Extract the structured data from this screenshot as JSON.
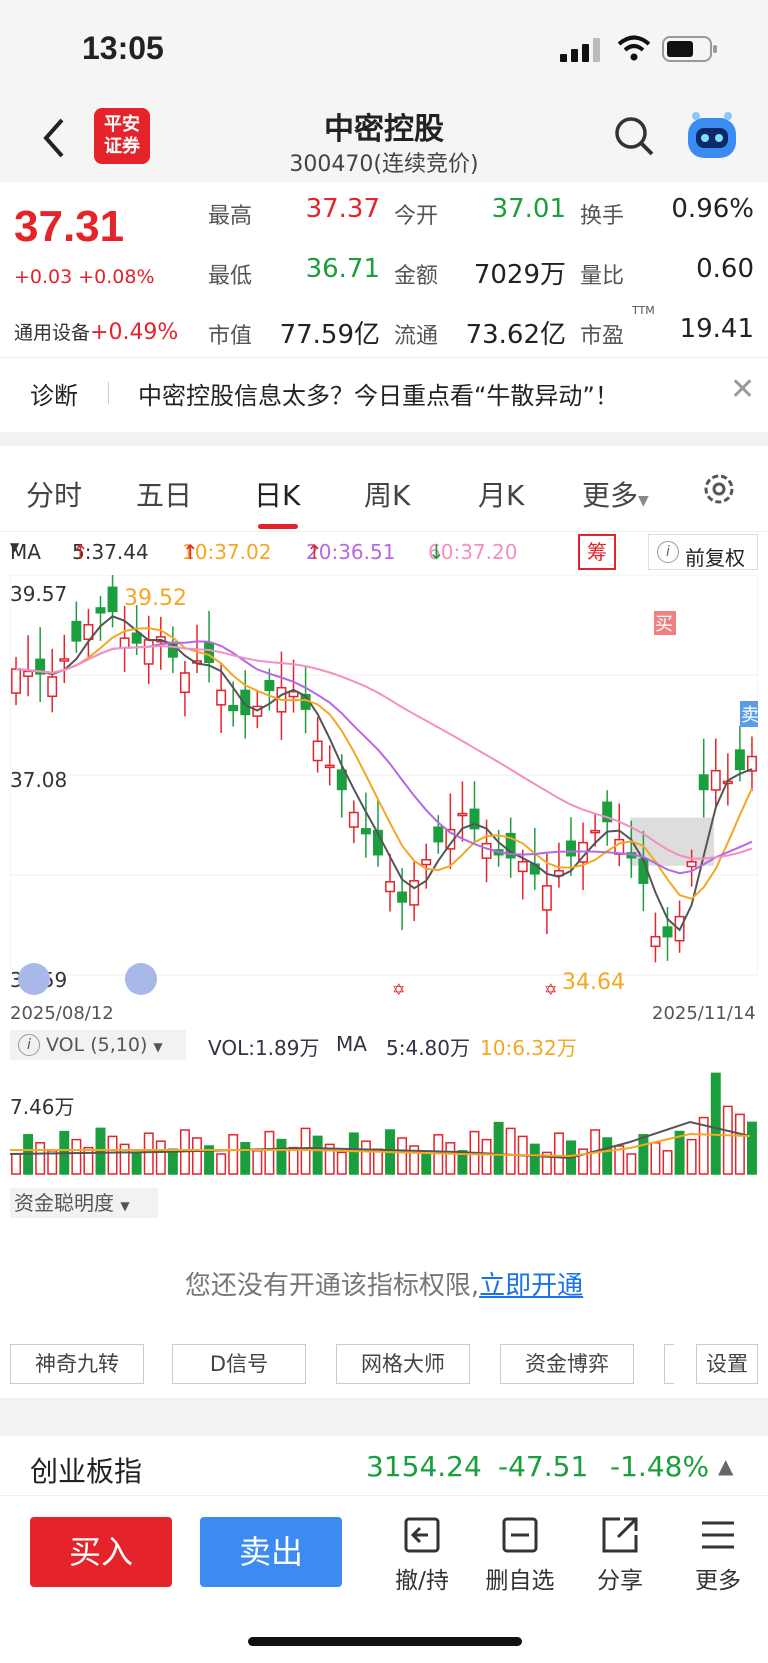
{
  "status_bar": {
    "time": "13:05"
  },
  "header": {
    "title": "中密控股",
    "subtitle": "300470(连续竞价)",
    "logo_text": "平安证券"
  },
  "quote": {
    "price": "37.31",
    "change": "+0.03 +0.08%",
    "sector_label": "通用设备",
    "sector_change": "+0.49%",
    "fields": [
      {
        "label": "最高",
        "value": "37.37",
        "color": "#e4232b"
      },
      {
        "label": "今开",
        "value": "37.01",
        "color": "#1b9e3e"
      },
      {
        "label": "换手",
        "value": "0.96%",
        "color": "#222222"
      },
      {
        "label": "最低",
        "value": "36.71",
        "color": "#1b9e3e"
      },
      {
        "label": "金额",
        "value": "7029万",
        "color": "#222222"
      },
      {
        "label": "量比",
        "value": "0.60",
        "color": "#222222"
      },
      {
        "label": "市值",
        "value": "77.59亿",
        "color": "#222222"
      },
      {
        "label": "流通",
        "value": "73.62亿",
        "color": "#222222"
      },
      {
        "label": "市盈",
        "value": "19.41",
        "color": "#222222"
      }
    ],
    "pe_suffix": "TTM"
  },
  "notice": {
    "tag": "诊断",
    "message": "中密控股信息太多？今日重点看“牛散异动”！"
  },
  "tabs": [
    "分时",
    "五日",
    "日K",
    "周K",
    "月K",
    "更多"
  ],
  "active_tab": "日K",
  "ma_bar": {
    "label": "MA",
    "ma5": "5:37.44",
    "ma10": "10:37.02",
    "ma20": "20:36.51",
    "ma60": "60:37.20",
    "chou": "筹",
    "fq": "前复权"
  },
  "chart_data": {
    "type": "candlestick",
    "y_labels": [
      "39.57",
      "37.08",
      "34.59"
    ],
    "ylim": [
      34.59,
      39.57
    ],
    "x_start": "2025/08/12",
    "x_end": "2025/11/14",
    "annotations": {
      "high": "39.52",
      "low": "34.64",
      "buy": "买",
      "sell": "卖"
    },
    "colors": {
      "up": "#e4232b",
      "down": "#1b9e3e",
      "ma5": "#555555",
      "ma10": "#f5a623",
      "ma20": "#b36ae2",
      "ma60": "#f48fc4"
    }
  },
  "volume": {
    "indicator": "VOL (5,10)",
    "vol": "VOL:1.89万",
    "ma_label": "MA",
    "ma5": "5:4.80万",
    "ma10": "10:6.32万",
    "y_label": "7.46万"
  },
  "indicator_select": "资金聪明度",
  "no_privilege": {
    "text": "您还没有开通该指标权限,",
    "link": "立即开通"
  },
  "tool_buttons": [
    "神奇九转",
    "D信号",
    "网格大师",
    "资金博弈",
    "设置"
  ],
  "index_bar": {
    "name": "创业板指",
    "value": "3154.24",
    "change": "-47.51",
    "pct": "-1.48%"
  },
  "bottom": {
    "buy": "买入",
    "sell": "卖出",
    "actions": [
      "撤/持",
      "删自选",
      "分享",
      "更多"
    ]
  }
}
